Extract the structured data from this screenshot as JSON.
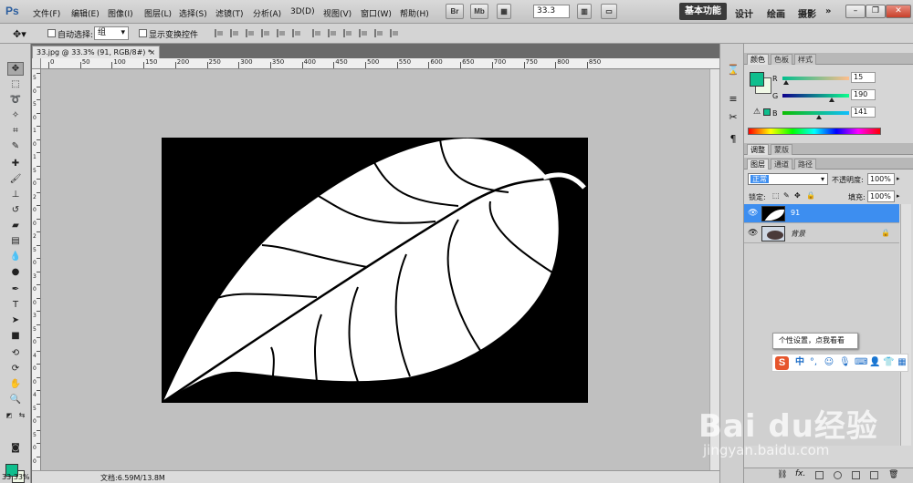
{
  "menubar": {
    "logo": "Ps",
    "items": [
      "文件(F)",
      "编辑(E)",
      "图像(I)",
      "图层(L)",
      "选择(S)",
      "滤镜(T)",
      "分析(A)",
      "3D(D)",
      "视图(V)",
      "窗口(W)",
      "帮助(H)"
    ],
    "bridge_label": "Br",
    "minibridge_label": "Mb",
    "zoom": "33.3",
    "workspaces": [
      "基本功能",
      "设计",
      "绘画",
      "摄影"
    ],
    "more": "»"
  },
  "options": {
    "auto_select_label": "自动选择:",
    "auto_select_value": "组",
    "show_transform_label": "显示变换控件"
  },
  "document": {
    "tab_title": "33.jpg @ 33.3% (91, RGB/8#) *",
    "tab_close": "×",
    "ruler_labels": [
      "0",
      "50",
      "100",
      "150",
      "200",
      "250",
      "300",
      "350",
      "400",
      "450",
      "500",
      "550",
      "600",
      "650",
      "700",
      "750",
      "800",
      "850"
    ],
    "ruler_v_labels": [
      "5",
      "0",
      "5",
      "0",
      "1",
      "0",
      "1",
      "5",
      "0",
      "2",
      "0",
      "0",
      "2",
      "5",
      "0",
      "3",
      "0",
      "0",
      "3",
      "5",
      "0",
      "4",
      "0",
      "0",
      "4",
      "5",
      "0",
      "5",
      "0",
      "0"
    ],
    "zoom_level": "33.33%",
    "doc_size": "文档:6.59M/13.8M"
  },
  "color_panel": {
    "tabs": [
      "颜色",
      "色板",
      "样式"
    ],
    "channels": [
      {
        "label": "R",
        "value": "15",
        "fraction": 0.06
      },
      {
        "label": "G",
        "value": "190",
        "fraction": 0.745
      },
      {
        "label": "B",
        "value": "141",
        "fraction": 0.553
      }
    ],
    "fg_color": "#0fbe8d",
    "bg_color": "#f0f8e6"
  },
  "adjust_panel": {
    "tabs": [
      "调整",
      "蒙版"
    ]
  },
  "layers_panel": {
    "tabs": [
      "图层",
      "通道",
      "路径"
    ],
    "blend_mode": "正常",
    "opacity_label": "不透明度:",
    "opacity": "100%",
    "lock_label": "锁定:",
    "fill_label": "填充:",
    "fill": "100%",
    "layers": [
      {
        "name": "91",
        "selected": true
      },
      {
        "name": "背景",
        "selected": false,
        "locked": true
      }
    ]
  },
  "ime": {
    "tooltip": "个性设置，点我看看",
    "mode": "中",
    "punct": "°,",
    "icons": [
      "smile-icon",
      "mic-icon",
      "keyboard-icon",
      "person-icon",
      "shirt-icon",
      "grid-icon"
    ]
  },
  "watermark": {
    "logo": "Bai du经验",
    "url": "jingyan.baidu.com"
  }
}
